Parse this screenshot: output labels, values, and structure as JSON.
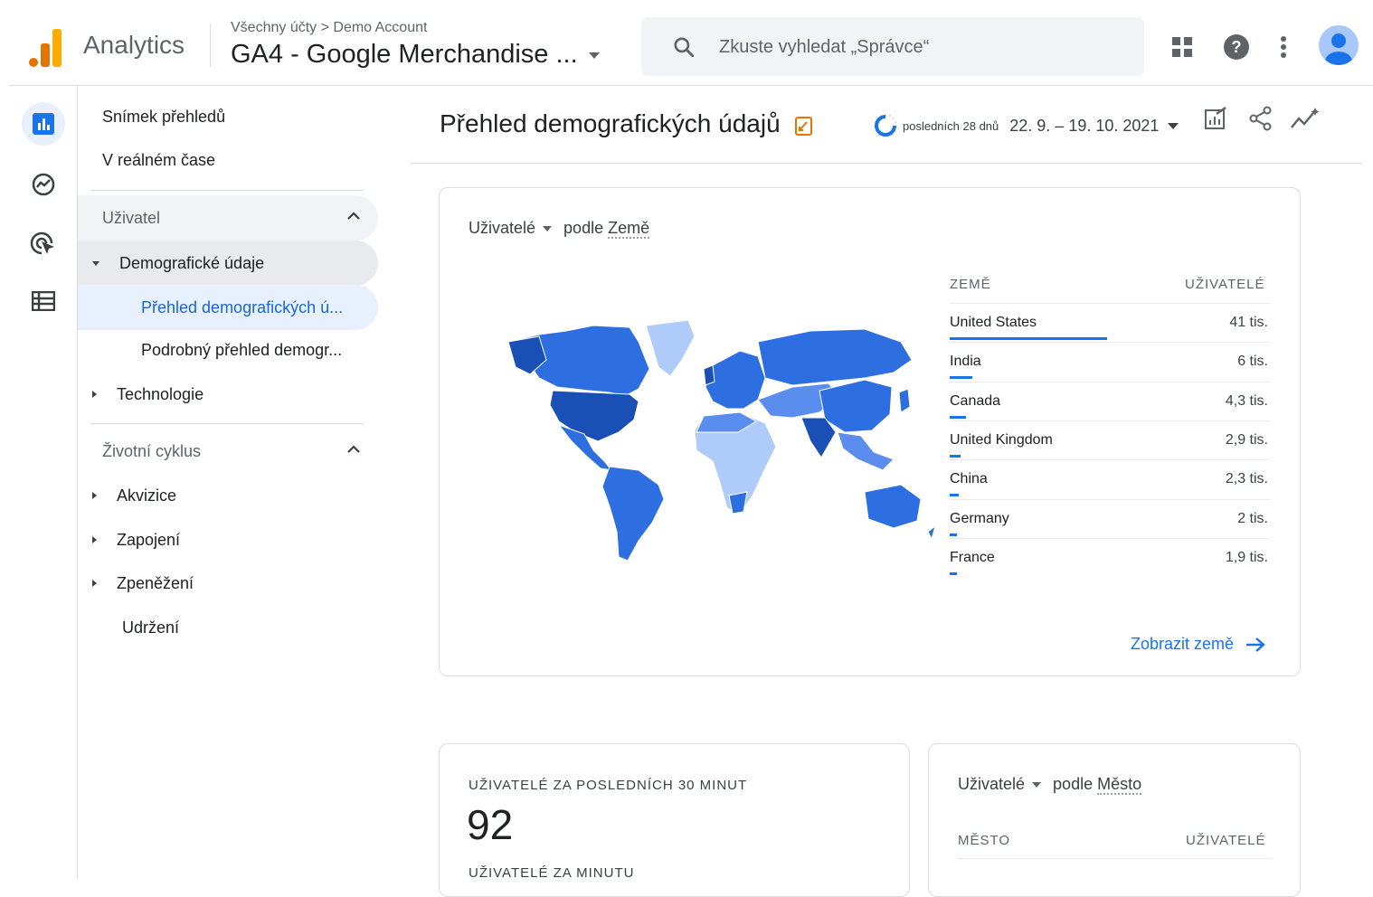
{
  "app": {
    "brand": "Analytics"
  },
  "header": {
    "breadcrumb": "Všechny účty > Demo Account",
    "property": "GA4 - Google Merchandise ...",
    "search_placeholder": "Zkuste vyhledat „Správce“"
  },
  "rail": {
    "icons": [
      "reports-icon",
      "explore-icon",
      "advertising-icon",
      "configure-icon"
    ]
  },
  "nav": {
    "snapshot": "Snímek přehledů",
    "realtime": "V reálném čase",
    "group_user": "Uživatel",
    "demographics": "Demografické údaje",
    "demographics_overview": "Přehled demografických ú...",
    "demographics_detail": "Podrobný přehled demogr...",
    "technology": "Technologie",
    "group_lifecycle": "Životní cyklus",
    "acquisition": "Akvizice",
    "engagement": "Zapojení",
    "monetization": "Zpeněžení",
    "retention": "Udržení"
  },
  "page": {
    "title": "Přehled demografických údajů",
    "date_label": "posledních 28 dnů",
    "date_range": "22. 9. – 19. 10. 2021"
  },
  "country_card": {
    "metric": "Uživatelé",
    "by": "podle",
    "dimension": "Země",
    "col_dimension": "ZEMĚ",
    "col_metric": "UŽIVATELÉ",
    "rows": [
      {
        "name": "United States",
        "value": "41 tis.",
        "users": 41000
      },
      {
        "name": "India",
        "value": "6 tis.",
        "users": 6000
      },
      {
        "name": "Canada",
        "value": "4,3 tis.",
        "users": 4300
      },
      {
        "name": "United Kingdom",
        "value": "2,9 tis.",
        "users": 2900
      },
      {
        "name": "China",
        "value": "2,3 tis.",
        "users": 2300
      },
      {
        "name": "Germany",
        "value": "2 tis.",
        "users": 2000
      },
      {
        "name": "France",
        "value": "1,9 tis.",
        "users": 1900
      }
    ],
    "link": "Zobrazit země"
  },
  "realtime_card": {
    "label": "UŽIVATELÉ ZA POSLEDNÍCH 30 MINUT",
    "value": "92",
    "sublabel": "UŽIVATELÉ ZA MINUTU"
  },
  "city_card": {
    "metric": "Uživatelé",
    "by": "podle",
    "dimension": "Město",
    "col_dimension": "MĚSTO",
    "col_metric": "UŽIVATELÉ"
  },
  "colors": {
    "accent": "#1a73e8",
    "orange": "#f9ab00",
    "map_dark": "#1a4fb5",
    "map_mid": "#2d6ee0",
    "map_light": "#aecbfa"
  }
}
